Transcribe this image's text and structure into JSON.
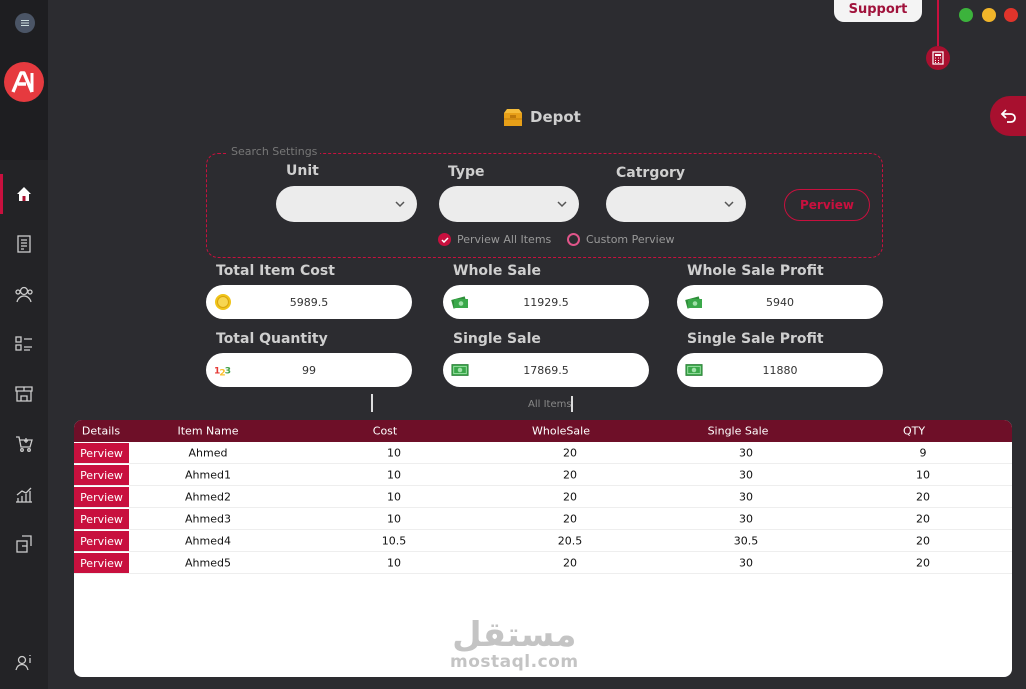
{
  "header": {
    "support_label": "Support",
    "page_title": "Depot"
  },
  "colors": {
    "accent": "#c8103e",
    "header_bg": "#6e0f28",
    "bg": "#2c2c30",
    "sidebar": "#232326"
  },
  "sidebar": {
    "logo": "AI",
    "items": [
      {
        "icon": "home-icon",
        "active": true
      },
      {
        "icon": "document-icon"
      },
      {
        "icon": "users-icon"
      },
      {
        "icon": "checklist-icon"
      },
      {
        "icon": "store-icon"
      },
      {
        "icon": "cart-icon"
      },
      {
        "icon": "chart-icon"
      },
      {
        "icon": "export-icon"
      }
    ],
    "bottom_icon": "user-info-icon"
  },
  "search": {
    "legend": "Search Settings",
    "unit_label": "Unit",
    "type_label": "Type",
    "category_label": "Catrgory",
    "unit_value": "",
    "type_value": "",
    "category_value": "",
    "preview_button": "Perview",
    "radio_all": "Perview All Items",
    "radio_custom": "Custom Perview",
    "selected_radio": "all"
  },
  "stats": {
    "total_item_cost": {
      "label": "Total Item Cost",
      "value": "5989.5",
      "icon": "coin-icon"
    },
    "whole_sale": {
      "label": "Whole Sale",
      "value": "11929.5",
      "icon": "cash-icon"
    },
    "whole_sale_profit": {
      "label": "Whole Sale Profit",
      "value": "5940",
      "icon": "cash-icon"
    },
    "total_quantity": {
      "label": "Total Quantity",
      "value": "99",
      "icon": "numbers-icon"
    },
    "single_sale": {
      "label": "Single Sale",
      "value": "17869.5",
      "icon": "banknote-icon"
    },
    "single_sale_profit": {
      "label": "Single Sale Profit",
      "value": "11880",
      "icon": "banknote-icon"
    }
  },
  "all_items_label": "All Items",
  "table": {
    "columns": [
      "Details",
      "Item Name",
      "Cost",
      "WholeSale",
      "Single Sale",
      "QTY"
    ],
    "row_button": "Perview",
    "rows": [
      [
        "Ahmed",
        "10",
        "20",
        "30",
        "9"
      ],
      [
        "Ahmed1",
        "10",
        "20",
        "30",
        "10"
      ],
      [
        "Ahmed2",
        "10",
        "20",
        "30",
        "20"
      ],
      [
        "Ahmed3",
        "10",
        "20",
        "30",
        "20"
      ],
      [
        "Ahmed4",
        "10.5",
        "20.5",
        "30.5",
        "20"
      ],
      [
        "Ahmed5",
        "10",
        "20",
        "30",
        "20"
      ]
    ]
  },
  "watermark": {
    "arabic": "مستقل",
    "latin": "mostaql.com"
  }
}
